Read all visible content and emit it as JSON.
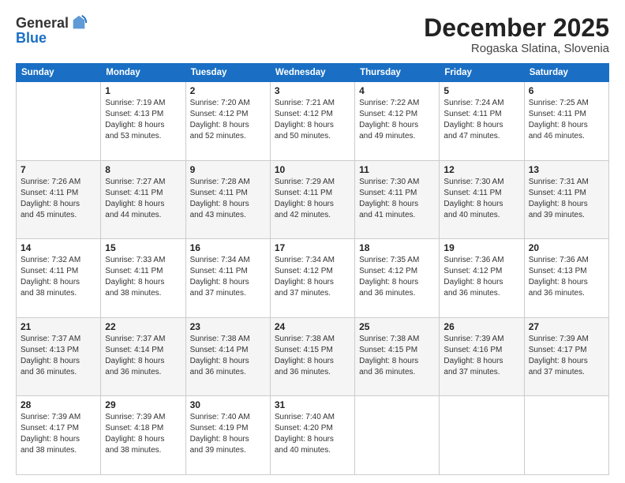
{
  "logo": {
    "general": "General",
    "blue": "Blue"
  },
  "title": "December 2025",
  "subtitle": "Rogaska Slatina, Slovenia",
  "weekdays": [
    "Sunday",
    "Monday",
    "Tuesday",
    "Wednesday",
    "Thursday",
    "Friday",
    "Saturday"
  ],
  "weeks": [
    [
      {
        "day": "",
        "info": ""
      },
      {
        "day": "1",
        "info": "Sunrise: 7:19 AM\nSunset: 4:13 PM\nDaylight: 8 hours\nand 53 minutes."
      },
      {
        "day": "2",
        "info": "Sunrise: 7:20 AM\nSunset: 4:12 PM\nDaylight: 8 hours\nand 52 minutes."
      },
      {
        "day": "3",
        "info": "Sunrise: 7:21 AM\nSunset: 4:12 PM\nDaylight: 8 hours\nand 50 minutes."
      },
      {
        "day": "4",
        "info": "Sunrise: 7:22 AM\nSunset: 4:12 PM\nDaylight: 8 hours\nand 49 minutes."
      },
      {
        "day": "5",
        "info": "Sunrise: 7:24 AM\nSunset: 4:11 PM\nDaylight: 8 hours\nand 47 minutes."
      },
      {
        "day": "6",
        "info": "Sunrise: 7:25 AM\nSunset: 4:11 PM\nDaylight: 8 hours\nand 46 minutes."
      }
    ],
    [
      {
        "day": "7",
        "info": "Sunrise: 7:26 AM\nSunset: 4:11 PM\nDaylight: 8 hours\nand 45 minutes."
      },
      {
        "day": "8",
        "info": "Sunrise: 7:27 AM\nSunset: 4:11 PM\nDaylight: 8 hours\nand 44 minutes."
      },
      {
        "day": "9",
        "info": "Sunrise: 7:28 AM\nSunset: 4:11 PM\nDaylight: 8 hours\nand 43 minutes."
      },
      {
        "day": "10",
        "info": "Sunrise: 7:29 AM\nSunset: 4:11 PM\nDaylight: 8 hours\nand 42 minutes."
      },
      {
        "day": "11",
        "info": "Sunrise: 7:30 AM\nSunset: 4:11 PM\nDaylight: 8 hours\nand 41 minutes."
      },
      {
        "day": "12",
        "info": "Sunrise: 7:30 AM\nSunset: 4:11 PM\nDaylight: 8 hours\nand 40 minutes."
      },
      {
        "day": "13",
        "info": "Sunrise: 7:31 AM\nSunset: 4:11 PM\nDaylight: 8 hours\nand 39 minutes."
      }
    ],
    [
      {
        "day": "14",
        "info": "Sunrise: 7:32 AM\nSunset: 4:11 PM\nDaylight: 8 hours\nand 38 minutes."
      },
      {
        "day": "15",
        "info": "Sunrise: 7:33 AM\nSunset: 4:11 PM\nDaylight: 8 hours\nand 38 minutes."
      },
      {
        "day": "16",
        "info": "Sunrise: 7:34 AM\nSunset: 4:11 PM\nDaylight: 8 hours\nand 37 minutes."
      },
      {
        "day": "17",
        "info": "Sunrise: 7:34 AM\nSunset: 4:12 PM\nDaylight: 8 hours\nand 37 minutes."
      },
      {
        "day": "18",
        "info": "Sunrise: 7:35 AM\nSunset: 4:12 PM\nDaylight: 8 hours\nand 36 minutes."
      },
      {
        "day": "19",
        "info": "Sunrise: 7:36 AM\nSunset: 4:12 PM\nDaylight: 8 hours\nand 36 minutes."
      },
      {
        "day": "20",
        "info": "Sunrise: 7:36 AM\nSunset: 4:13 PM\nDaylight: 8 hours\nand 36 minutes."
      }
    ],
    [
      {
        "day": "21",
        "info": "Sunrise: 7:37 AM\nSunset: 4:13 PM\nDaylight: 8 hours\nand 36 minutes."
      },
      {
        "day": "22",
        "info": "Sunrise: 7:37 AM\nSunset: 4:14 PM\nDaylight: 8 hours\nand 36 minutes."
      },
      {
        "day": "23",
        "info": "Sunrise: 7:38 AM\nSunset: 4:14 PM\nDaylight: 8 hours\nand 36 minutes."
      },
      {
        "day": "24",
        "info": "Sunrise: 7:38 AM\nSunset: 4:15 PM\nDaylight: 8 hours\nand 36 minutes."
      },
      {
        "day": "25",
        "info": "Sunrise: 7:38 AM\nSunset: 4:15 PM\nDaylight: 8 hours\nand 36 minutes."
      },
      {
        "day": "26",
        "info": "Sunrise: 7:39 AM\nSunset: 4:16 PM\nDaylight: 8 hours\nand 37 minutes."
      },
      {
        "day": "27",
        "info": "Sunrise: 7:39 AM\nSunset: 4:17 PM\nDaylight: 8 hours\nand 37 minutes."
      }
    ],
    [
      {
        "day": "28",
        "info": "Sunrise: 7:39 AM\nSunset: 4:17 PM\nDaylight: 8 hours\nand 38 minutes."
      },
      {
        "day": "29",
        "info": "Sunrise: 7:39 AM\nSunset: 4:18 PM\nDaylight: 8 hours\nand 38 minutes."
      },
      {
        "day": "30",
        "info": "Sunrise: 7:40 AM\nSunset: 4:19 PM\nDaylight: 8 hours\nand 39 minutes."
      },
      {
        "day": "31",
        "info": "Sunrise: 7:40 AM\nSunset: 4:20 PM\nDaylight: 8 hours\nand 40 minutes."
      },
      {
        "day": "",
        "info": ""
      },
      {
        "day": "",
        "info": ""
      },
      {
        "day": "",
        "info": ""
      }
    ]
  ]
}
